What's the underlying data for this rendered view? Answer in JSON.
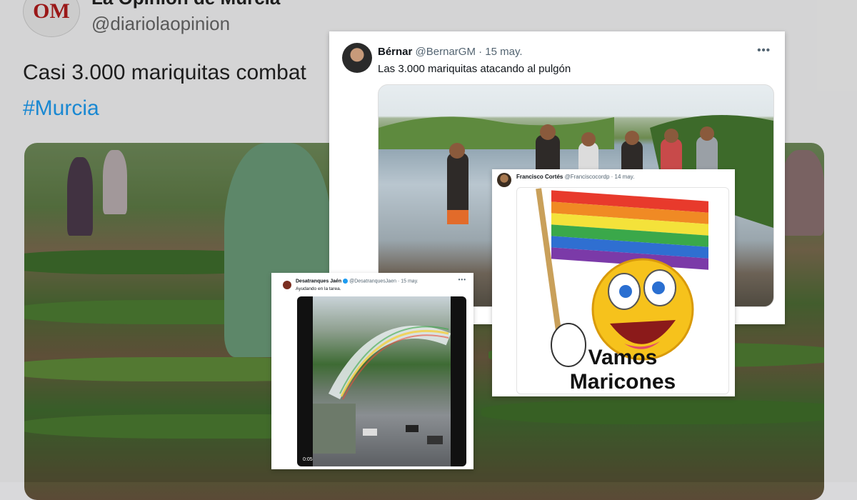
{
  "background_tweet": {
    "logo_text": "OM",
    "account_name": "La Opinión de Murcia",
    "handle": "@diariolaopinion",
    "text": "Casi 3.000 mariquitas combat",
    "hashtag": "#Murcia"
  },
  "tweets": [
    {
      "id": "bernar",
      "name": "Bérnar",
      "handle": "@BernarGM",
      "separator": "·",
      "date": "15 may.",
      "text": "Las 3.000 mariquitas atacando al pulgón",
      "more_icon": "more-dots-icon"
    },
    {
      "id": "francisco",
      "name": "Francisco Cortés",
      "handle": "@Franciscocordp",
      "separator": "·",
      "date": "14 may.",
      "image_text_line1": "Vamos",
      "image_text_line2": "Maricones"
    },
    {
      "id": "desatranques",
      "name": "Desatranques Jaén",
      "verified_icon": "verified-badge-icon",
      "handle": "@DesatranquesJaen",
      "separator": "·",
      "date": "15 may.",
      "text": "Ayudando en la tarea.",
      "video_time": "0:05",
      "more_icon": "more-dots-icon"
    }
  ],
  "colors": {
    "link": "#1d9bf0",
    "text": "#0f1419",
    "muted": "#536471",
    "brand_red": "#b01c1c"
  }
}
